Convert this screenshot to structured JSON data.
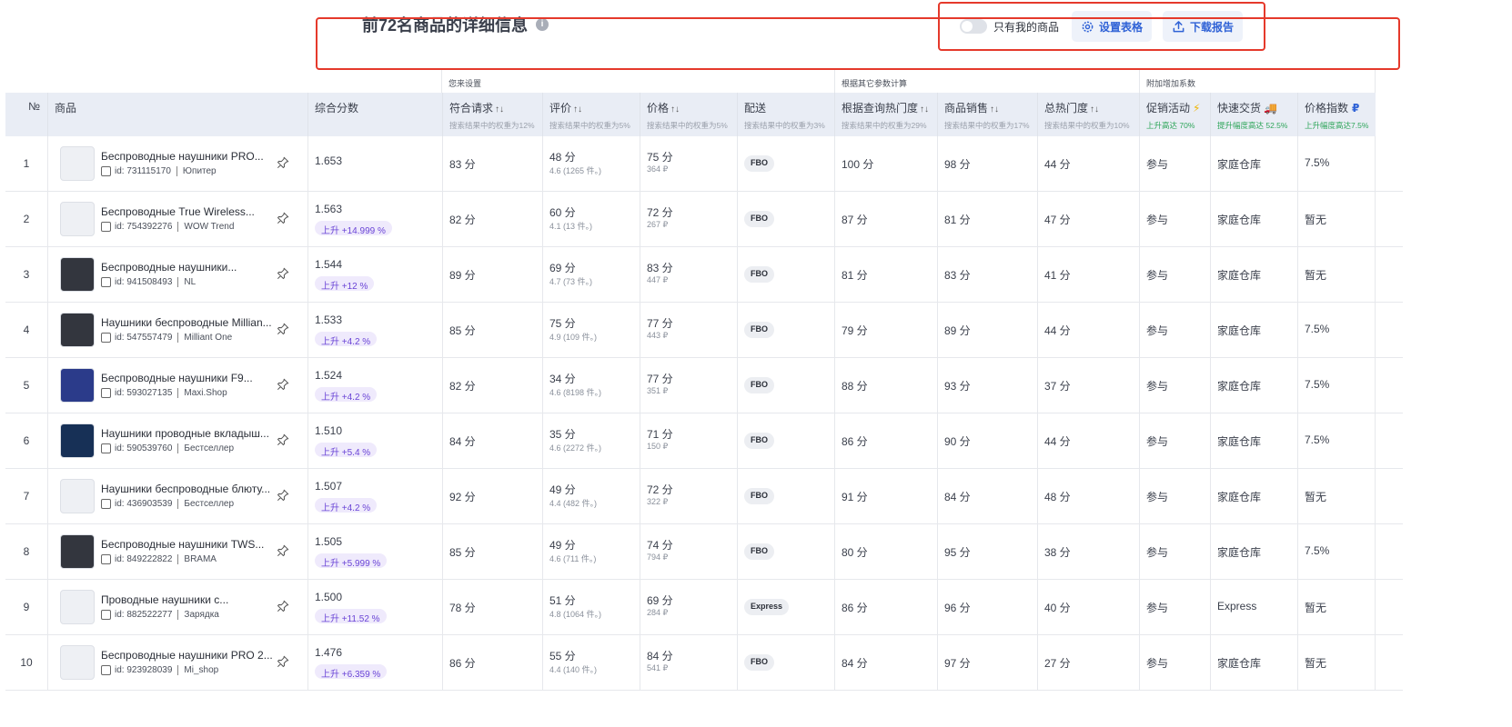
{
  "title": "前72名商品的详细信息",
  "toolbar": {
    "toggle_label": "只有我的商品",
    "settings_label": "设置表格",
    "download_label": "下载报告"
  },
  "groups": {
    "you_set": "您来设置",
    "calc": "根据其它参数计算",
    "extra": "附加增加系数"
  },
  "headers": {
    "no": "№",
    "product": "商品",
    "score": "综合分数",
    "match": "符合请求",
    "match_sub": "搜索结果中的权重为12%",
    "rating": "评价",
    "rating_sub": "搜索结果中的权重为5%",
    "price": "价格",
    "price_sub": "搜索结果中的权重为5%",
    "delivery": "配送",
    "delivery_sub": "搜索结果中的权重为3%",
    "query": "根据查询热门度",
    "query_sub": "搜索结果中的权重为29%",
    "sales": "商品销售",
    "sales_sub": "搜索结果中的权重为17%",
    "total": "总热门度",
    "total_sub": "搜索结果中的权重为10%",
    "promo": "促销活动",
    "promo_sub": "上升高达 70%",
    "fast": "快速交货",
    "fast_sub": "提升幅度高达 52.5%",
    "priceidx": "价格指数",
    "priceidx_sub": "上升幅度高达7.5%"
  },
  "rows": [
    {
      "no": "1",
      "name": "Беспроводные наушники PRO...",
      "id": "id: 731115170",
      "seller": "Юпитер",
      "score": "1.653",
      "badge": "",
      "match": "83 分",
      "rating": "48 分",
      "rating_sub": "4.6 (1265 件。)",
      "price": "75 分",
      "price_sub": "364 ₽",
      "delivery": "FBO",
      "query": "100 分",
      "sales": "98 分",
      "total": "44 分",
      "promo": "参与",
      "fast": "家庭仓库",
      "priceidx": "7.5%"
    },
    {
      "no": "2",
      "name": "Беспроводные True Wireless...",
      "id": "id: 754392276",
      "seller": "WOW Trend",
      "score": "1.563",
      "badge": "上升 +14.999 %",
      "match": "82 分",
      "rating": "60 分",
      "rating_sub": "4.1 (13 件。)",
      "price": "72 分",
      "price_sub": "267 ₽",
      "delivery": "FBO",
      "query": "87 分",
      "sales": "81 分",
      "total": "47 分",
      "promo": "参与",
      "fast": "家庭仓库",
      "priceidx": "暂无"
    },
    {
      "no": "3",
      "name": "Беспроводные наушники...",
      "id": "id: 941508493",
      "seller": "NL",
      "score": "1.544",
      "badge": "上升 +12 %",
      "match": "89 分",
      "rating": "69 分",
      "rating_sub": "4.7 (73 件。)",
      "price": "83 分",
      "price_sub": "447 ₽",
      "delivery": "FBO",
      "query": "81 分",
      "sales": "83 分",
      "total": "41 分",
      "promo": "参与",
      "fast": "家庭仓库",
      "priceidx": "暂无"
    },
    {
      "no": "4",
      "name": "Наушники беспроводные Millian...",
      "id": "id: 547557479",
      "seller": "Milliant One",
      "score": "1.533",
      "badge": "上升 +4.2 %",
      "match": "85 分",
      "rating": "75 分",
      "rating_sub": "4.9 (109 件。)",
      "price": "77 分",
      "price_sub": "443 ₽",
      "delivery": "FBO",
      "query": "79 分",
      "sales": "89 分",
      "total": "44 分",
      "promo": "参与",
      "fast": "家庭仓库",
      "priceidx": "7.5%"
    },
    {
      "no": "5",
      "name": "Беспроводные наушники F9...",
      "id": "id: 593027135",
      "seller": "Maxi.Shop",
      "score": "1.524",
      "badge": "上升 +4.2 %",
      "match": "82 分",
      "rating": "34 分",
      "rating_sub": "4.6 (8198 件。)",
      "price": "77 分",
      "price_sub": "351 ₽",
      "delivery": "FBO",
      "query": "88 分",
      "sales": "93 分",
      "total": "37 分",
      "promo": "参与",
      "fast": "家庭仓库",
      "priceidx": "7.5%"
    },
    {
      "no": "6",
      "name": "Наушники проводные вкладыш...",
      "id": "id: 590539760",
      "seller": "Бестселлер",
      "score": "1.510",
      "badge": "上升 +5.4 %",
      "match": "84 分",
      "rating": "35 分",
      "rating_sub": "4.6 (2272 件。)",
      "price": "71 分",
      "price_sub": "150 ₽",
      "delivery": "FBO",
      "query": "86 分",
      "sales": "90 分",
      "total": "44 分",
      "promo": "参与",
      "fast": "家庭仓库",
      "priceidx": "7.5%"
    },
    {
      "no": "7",
      "name": "Наушники беспроводные блюту...",
      "id": "id: 436903539",
      "seller": "Бестселлер",
      "score": "1.507",
      "badge": "上升 +4.2 %",
      "match": "92 分",
      "rating": "49 分",
      "rating_sub": "4.4 (482 件。)",
      "price": "72 分",
      "price_sub": "322 ₽",
      "delivery": "FBO",
      "query": "91 分",
      "sales": "84 分",
      "total": "48 分",
      "promo": "参与",
      "fast": "家庭仓库",
      "priceidx": "暂无"
    },
    {
      "no": "8",
      "name": "Беспроводные наушники TWS...",
      "id": "id: 849222822",
      "seller": "BRAMA",
      "score": "1.505",
      "badge": "上升 +5.999 %",
      "match": "85 分",
      "rating": "49 分",
      "rating_sub": "4.6 (711 件。)",
      "price": "74 分",
      "price_sub": "794 ₽",
      "delivery": "FBO",
      "query": "80 分",
      "sales": "95 分",
      "total": "38 分",
      "promo": "参与",
      "fast": "家庭仓库",
      "priceidx": "7.5%"
    },
    {
      "no": "9",
      "name": "Проводные наушники с...",
      "id": "id: 882522277",
      "seller": "Зарядка",
      "score": "1.500",
      "badge": "上升 +11.52 %",
      "match": "78 分",
      "rating": "51 分",
      "rating_sub": "4.8 (1064 件。)",
      "price": "69 分",
      "price_sub": "284 ₽",
      "delivery": "Express",
      "query": "86 分",
      "sales": "96 分",
      "total": "40 分",
      "promo": "参与",
      "fast": "Express",
      "priceidx": "暂无"
    },
    {
      "no": "10",
      "name": "Беспроводные наушники PRO 2...",
      "id": "id: 923928039",
      "seller": "Mi_shop",
      "score": "1.476",
      "badge": "上升 +6.359 %",
      "match": "86 分",
      "rating": "55 分",
      "rating_sub": "4.4 (140 件。)",
      "price": "84 分",
      "price_sub": "541 ₽",
      "delivery": "FBO",
      "query": "84 分",
      "sales": "97 分",
      "total": "27 分",
      "promo": "参与",
      "fast": "家庭仓库",
      "priceidx": "暂无"
    }
  ]
}
